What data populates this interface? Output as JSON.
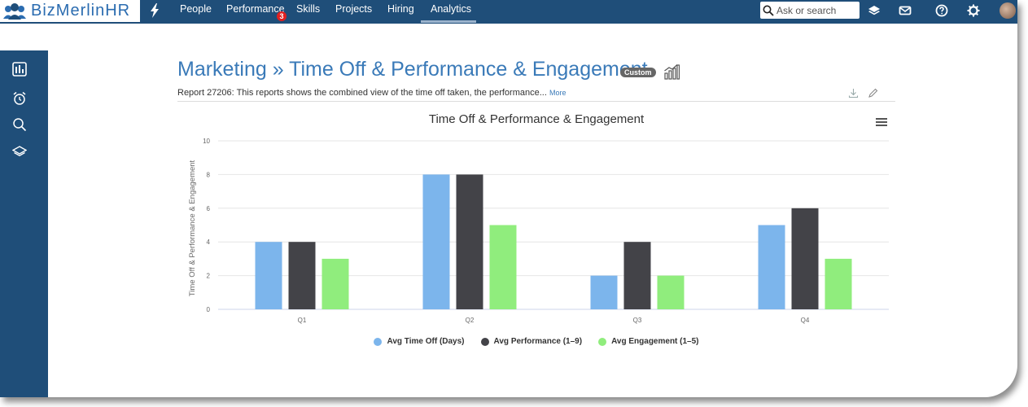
{
  "app": {
    "brand": "BizMerlinHR"
  },
  "nav": {
    "items": [
      {
        "label": "People"
      },
      {
        "label": "Performance",
        "badge": "3"
      },
      {
        "label": "Skills"
      },
      {
        "label": "Projects"
      },
      {
        "label": "Hiring"
      },
      {
        "label": "Analytics",
        "active": true
      }
    ]
  },
  "search": {
    "placeholder": "Ask or search"
  },
  "report": {
    "title": "Marketing » Time Off & Performance & Engagement",
    "badge": "Custom",
    "description": "Report  27206: This reports shows the combined view of the time off taken, the performance...",
    "more_label": "More"
  },
  "chart_data": {
    "type": "bar",
    "title": "Time Off & Performance & Engagement",
    "ylabel": "Time Off & Performance & Engagement",
    "xlabel": "",
    "categories": [
      "Q1",
      "Q2",
      "Q3",
      "Q4"
    ],
    "ylim": [
      0,
      10
    ],
    "yticks": [
      0,
      2,
      4,
      6,
      8,
      10
    ],
    "grid": true,
    "legend_position": "bottom",
    "series": [
      {
        "name": "Avg Time Off (Days)",
        "color": "#7cb5ec",
        "values": [
          4,
          8,
          2,
          5
        ]
      },
      {
        "name": "Avg Performance (1–9)",
        "color": "#434348",
        "values": [
          4,
          8,
          4,
          6
        ]
      },
      {
        "name": "Avg Engagement (1–5)",
        "color": "#90ed7d",
        "values": [
          3,
          5,
          2,
          3
        ]
      }
    ]
  }
}
